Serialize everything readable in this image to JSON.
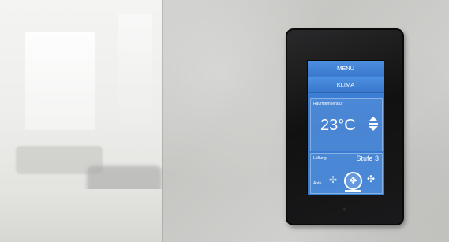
{
  "thermostat": {
    "menu_label": "MENÜ",
    "klima_label": "KLIMA",
    "room_temp_label": "Raumtemperatur",
    "temperature": "23°C",
    "ventilation_label": "Lüftung",
    "ventilation_level": "Stufe 3",
    "auto_label": "Auto",
    "fans": [
      {
        "icon": "fan-icon",
        "state": "inactive"
      },
      {
        "icon": "fan-icon",
        "state": "selected"
      },
      {
        "icon": "fan-icon",
        "state": "inactive"
      }
    ]
  },
  "colors": {
    "screen": "#3b7fd3",
    "device": "#111111",
    "wall": "#cfcfcd"
  }
}
